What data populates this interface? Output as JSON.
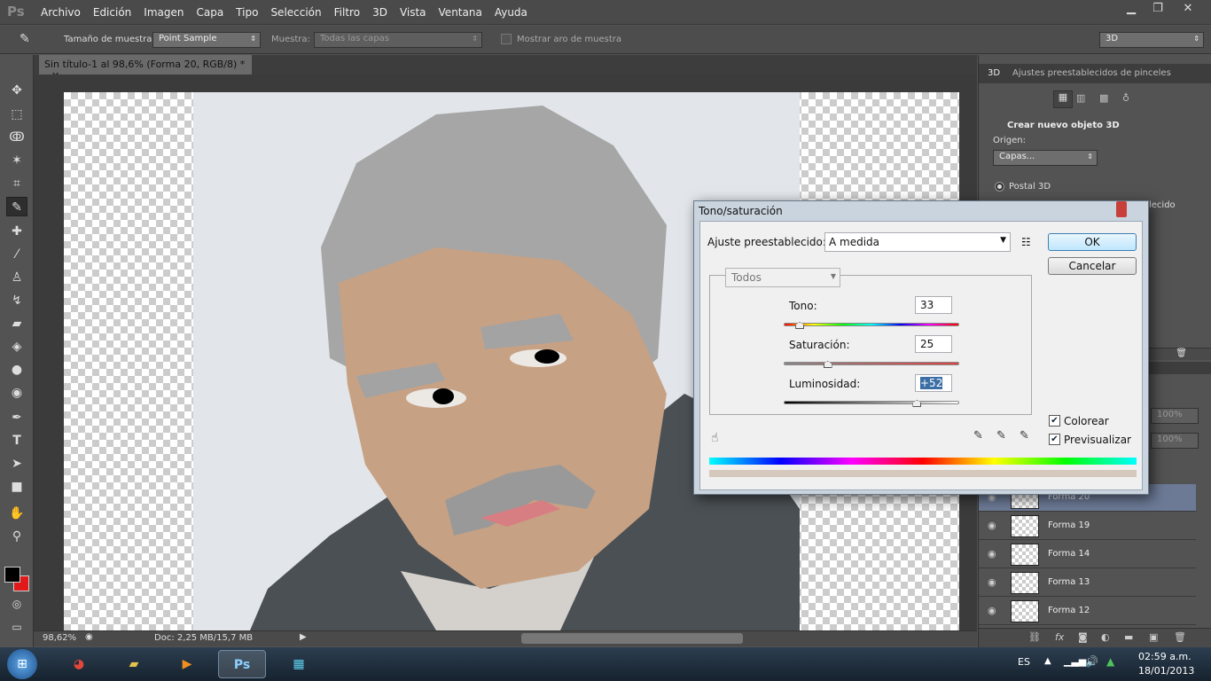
{
  "app": {
    "logo": "Ps",
    "menu": [
      "Archivo",
      "Edición",
      "Imagen",
      "Capa",
      "Tipo",
      "Selección",
      "Filtro",
      "3D",
      "Vista",
      "Ventana",
      "Ayuda"
    ]
  },
  "options": {
    "sample_size_label": "Tamaño de muestra:",
    "sample_size_value": "Point Sample",
    "sample_label": "Muestra:",
    "sample_value": "Todas las capas",
    "ring_label": "Mostrar aro de muestra",
    "workspace": "3D"
  },
  "document": {
    "tab_title": "Sin título-1 al 98,6% (Forma 20, RGB/8) *",
    "zoom": "98,62%",
    "doc_info": "Doc: 2,25 MB/15,7 MB"
  },
  "panel3d": {
    "tab_3d": "3D",
    "tab_brush": "Ajustes preestablecidos de pinceles",
    "create_title": "Crear nuevo objeto 3D",
    "origin_label": "Origen:",
    "origin_value": "Capas...",
    "postal": "Postal 3D",
    "partial": "lecido"
  },
  "layers": {
    "opacity": "100%",
    "fill": "100%",
    "items": [
      {
        "name": "Forma 20"
      },
      {
        "name": "Forma 19"
      },
      {
        "name": "Forma 14"
      },
      {
        "name": "Forma 13"
      },
      {
        "name": "Forma 12"
      }
    ]
  },
  "dialog": {
    "title": "Tono/saturación",
    "preset_label": "Ajuste preestablecido:",
    "preset_value": "A medida",
    "channel": "Todos",
    "ok": "OK",
    "cancel": "Cancelar",
    "hue_label": "Tono:",
    "hue_value": "33",
    "hue": 33,
    "sat_label": "Saturación:",
    "sat_value": "25",
    "sat": 25,
    "light_label": "Luminosidad:",
    "light_value": "+52",
    "light": 52,
    "colorize": "Colorear",
    "preview": "Previsualizar"
  },
  "taskbar": {
    "lang": "ES",
    "time": "02:59 a.m.",
    "date": "18/01/2013",
    "icons": [
      "start-orb",
      "chrome",
      "explorer",
      "media",
      "photoshop",
      "app"
    ]
  },
  "colors": {
    "fg": "#000000",
    "bg": "#e01a1a",
    "skin": "#c7a184",
    "hair": "#a5a5a5"
  }
}
